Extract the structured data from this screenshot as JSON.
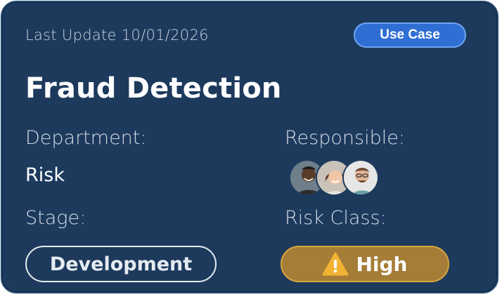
{
  "card": {
    "last_update": "Last Update 10/01/2026",
    "tag": "Use Case",
    "title": "Fraud Detection",
    "department_label": "Department:",
    "department_value": "Risk",
    "responsible_label": "Responsible:",
    "responsible_avatars": [
      "avatar-1",
      "avatar-2",
      "avatar-3"
    ],
    "stage_label": "Stage:",
    "stage_value": "Development",
    "risk_class_label": "Risk Class:",
    "risk_class_value": "High",
    "risk_icon": "warning-icon",
    "colors": {
      "background": "#1d3a5d",
      "tag": "#2f6fd4",
      "high": "#a57d37",
      "warning": "#f2b233"
    }
  }
}
